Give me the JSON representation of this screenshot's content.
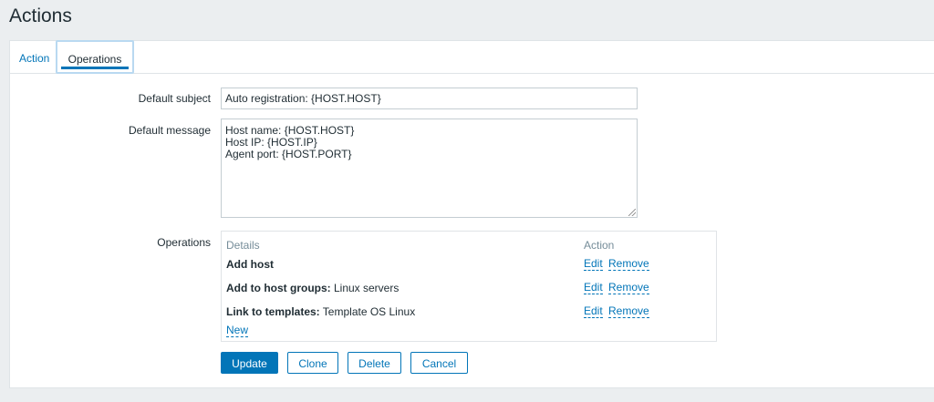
{
  "page": {
    "title": "Actions"
  },
  "tabs": [
    {
      "label": "Action"
    },
    {
      "label": "Operations"
    }
  ],
  "form": {
    "default_subject_label": "Default subject",
    "default_subject_value": "Auto registration: {HOST.HOST}",
    "default_message_label": "Default message",
    "default_message_value": "Host name: {HOST.HOST}\nHost IP: {HOST.IP}\nAgent port: {HOST.PORT}",
    "operations_label": "Operations"
  },
  "operations": {
    "header_details": "Details",
    "header_action": "Action",
    "rows": [
      {
        "bold": "Add host",
        "text": "",
        "edit": "Edit",
        "remove": "Remove"
      },
      {
        "bold": "Add to host groups:",
        "text": " Linux servers",
        "edit": "Edit",
        "remove": "Remove"
      },
      {
        "bold": "Link to templates:",
        "text": " Template OS Linux",
        "edit": "Edit",
        "remove": "Remove"
      }
    ],
    "new_label": "New"
  },
  "buttons": {
    "update": "Update",
    "clone": "Clone",
    "delete": "Delete",
    "cancel": "Cancel"
  }
}
